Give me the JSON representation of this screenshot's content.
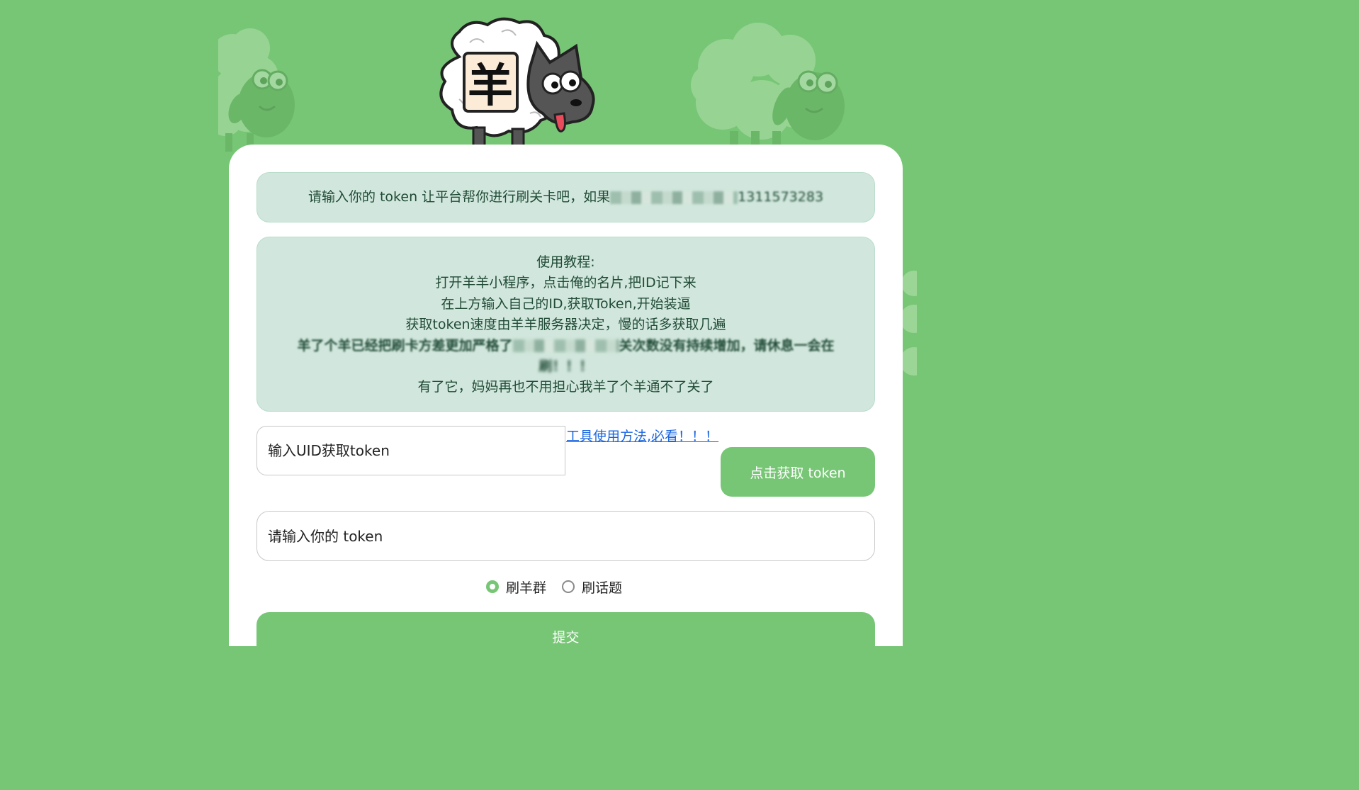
{
  "notice": {
    "text_prefix": "请输入你的 token 让平台帮你进行刷关卡吧，如果",
    "text_suffix": "1311573283"
  },
  "guide": {
    "title": "使用教程:",
    "step1": "打开羊羊小程序，点击俺的名片,把ID记下来",
    "step2": "在上方输入自己的ID,获取Token,开始装逼",
    "step3": "获取token速度由羊羊服务器决定，慢的话多获取几遍",
    "step4_prefix": "羊了个羊已经把刷卡方差更加严格了",
    "step4_suffix": "关次数没有持续增加，请休息一会在",
    "step4_tail": "刷！！！",
    "step5": "有了它，妈妈再也不用担心我羊了个羊通不了关了"
  },
  "uid_input": {
    "placeholder": "输入UID获取token"
  },
  "tool_link": {
    "label": "工具使用方法,必看！！！"
  },
  "get_token_button": {
    "label": "点击获取 token"
  },
  "token_input": {
    "placeholder": "请输入你的 token"
  },
  "mode_options": [
    {
      "label": "刷羊群",
      "selected": true
    },
    {
      "label": "刷话题",
      "selected": false
    }
  ],
  "submit_button": {
    "label": "提交"
  },
  "colors": {
    "primary": "#77c675",
    "alert_bg": "#d1e7dd",
    "link": "#1a66e0"
  }
}
